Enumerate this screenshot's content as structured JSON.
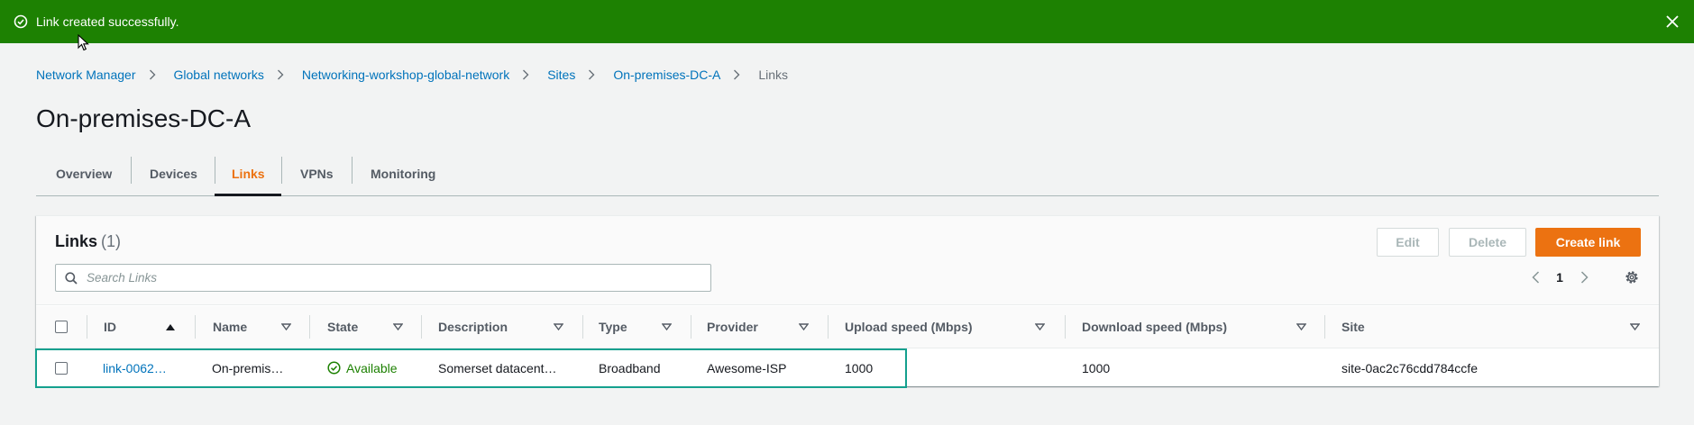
{
  "flash": {
    "message": "Link created successfully.",
    "colors": {
      "background": "#1d8102",
      "text": "#ffffff"
    }
  },
  "breadcrumb": [
    {
      "label": "Network Manager"
    },
    {
      "label": "Global networks"
    },
    {
      "label": "Networking-workshop-global-network"
    },
    {
      "label": "Sites"
    },
    {
      "label": "On-premises-DC-A"
    },
    {
      "label": "Links"
    }
  ],
  "page": {
    "title": "On-premises-DC-A"
  },
  "tabs": [
    {
      "label": "Overview",
      "active": false
    },
    {
      "label": "Devices",
      "active": false
    },
    {
      "label": "Links",
      "active": true
    },
    {
      "label": "VPNs",
      "active": false
    },
    {
      "label": "Monitoring",
      "active": false
    }
  ],
  "links_panel": {
    "title": "Links",
    "count": "(1)",
    "buttons": {
      "edit": "Edit",
      "delete": "Delete",
      "create": "Create link"
    },
    "search_placeholder": "Search Links",
    "page_number": "1",
    "columns": [
      "ID",
      "Name",
      "State",
      "Description",
      "Type",
      "Provider",
      "Upload speed (Mbps)",
      "Download speed (Mbps)",
      "Site"
    ],
    "rows": [
      {
        "id": "link-0062…",
        "name": "On-premis…",
        "state": "Available",
        "description": "Somerset datacent…",
        "type": "Broadband",
        "provider": "Awesome-ISP",
        "upload": "1000",
        "download": "1000",
        "site": "site-0ac2c76cdd784ccfe"
      }
    ]
  },
  "colors": {
    "accent": "#ec7211",
    "link": "#0073bb",
    "success": "#1d8102",
    "highlight": "#14a08e"
  }
}
